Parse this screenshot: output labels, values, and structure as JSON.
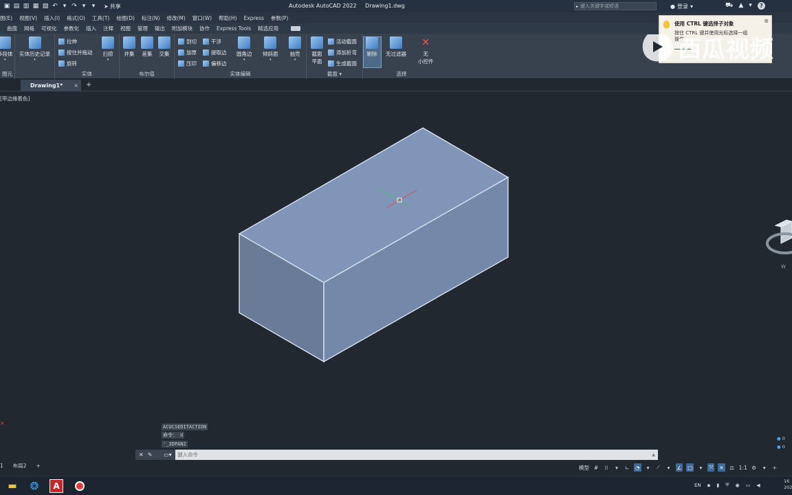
{
  "titlebar": {
    "app_title": "Autodesk AutoCAD 2022",
    "file_title": "Drawing1.dwg",
    "share_label": "共享",
    "search_placeholder": "键入关键字或短语",
    "login_label": "登录"
  },
  "menu": [
    "图(E)",
    "视图(V)",
    "插入(I)",
    "格式(O)",
    "工具(T)",
    "绘图(D)",
    "标注(N)",
    "修改(M)",
    "窗口(W)",
    "帮助(H)",
    "Express",
    "参数(P)"
  ],
  "ribbon_tabs": [
    "曲面",
    "网格",
    "可视化",
    "参数化",
    "插入",
    "注释",
    "视图",
    "管理",
    "输出",
    "附加模块",
    "协作",
    "Express Tools",
    "精选应用"
  ],
  "ribbon": {
    "groups": {
      "primitive": "图元",
      "solid": "实体",
      "boolean": "布尔值",
      "solid_edit": "实体编辑",
      "section": "截面",
      "selection": "选择"
    },
    "buttons": {
      "polysolid": "多段体",
      "solid_history": "实体历史记录",
      "extrude": "拉伸",
      "presspull": "按住并拖动",
      "revolve": "旋转",
      "sweep": "扫掠",
      "union": "并集",
      "subtract": "差集",
      "intersect": "交集",
      "slice": "剖切",
      "thicken": "加厚",
      "imprint": "压印",
      "interfere": "干涉",
      "extract_edges": "提取边",
      "offset_edges": "偏移边",
      "fillet_edge": "圆角边",
      "taper_faces": "倾斜面",
      "shell": "抽壳",
      "section_plane": "截面平面",
      "live_section": "活动截面",
      "add_jog": "添加折弯",
      "generate_section": "生成截面",
      "culling": "剔除",
      "no_filter": "无过滤器",
      "gizmo_none": "无",
      "gizmo": "小控件"
    }
  },
  "filetab": {
    "name": "Drawing1*"
  },
  "viewport": {
    "label": "[带边缘着色]"
  },
  "command": {
    "history": [
      "ACUCSEDITACTION",
      "命令： U",
      "'_3DPAN2"
    ],
    "placeholder": "键入命令"
  },
  "layout_tabs": [
    "1",
    "布局2"
  ],
  "status": {
    "model_label": "模型",
    "scale": "1:1"
  },
  "tooltip": {
    "title": "使用 CTRL 键选择子对象",
    "body": "按住 CTRL 键并使用光标选择一组",
    "body2": "操作"
  },
  "watermark": {
    "text": "西瓜视频"
  },
  "tray": {
    "lang": "EN"
  },
  "clock": {
    "time": "16",
    "date": "202"
  },
  "colors": {
    "box_top": "#8095b8",
    "box_front_left": "#6a7b98",
    "box_front_right": "#7488aa",
    "viewport_bg": "#212830"
  }
}
